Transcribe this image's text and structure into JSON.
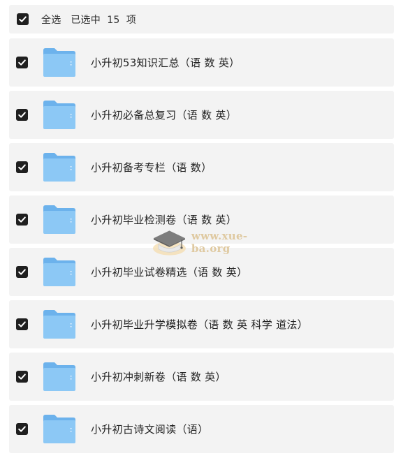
{
  "header": {
    "select_all_label": "全选   已选中  15  项",
    "select_all_checked": true
  },
  "items": [
    {
      "label": "小升初53知识汇总（语 数 英）",
      "checked": true,
      "icon": "folder-icon"
    },
    {
      "label": "小升初必备总复习（语 数 英）",
      "checked": true,
      "icon": "folder-icon"
    },
    {
      "label": "小升初备考专栏（语 数）",
      "checked": true,
      "icon": "folder-icon"
    },
    {
      "label": "小升初毕业检测卷（语 数 英）",
      "checked": true,
      "icon": "folder-icon"
    },
    {
      "label": "小升初毕业试卷精选（语 数 英）",
      "checked": true,
      "icon": "folder-icon"
    },
    {
      "label": "小升初毕业升学模拟卷（语 数 英 科学 道法）",
      "checked": true,
      "icon": "folder-icon"
    },
    {
      "label": "小升初冲刺新卷（语 数 英）",
      "checked": true,
      "icon": "folder-icon"
    },
    {
      "label": "小升初古诗文阅读（语）",
      "checked": true,
      "icon": "folder-icon"
    }
  ],
  "watermark": {
    "text": "www.xue-ba.org"
  },
  "colors": {
    "row_bg": "#f3f3f3",
    "checkbox": "#1f1f1f",
    "folder_front": "#8cc8f5",
    "folder_back": "#6cb2ec",
    "watermark": "#dfc9a0"
  }
}
